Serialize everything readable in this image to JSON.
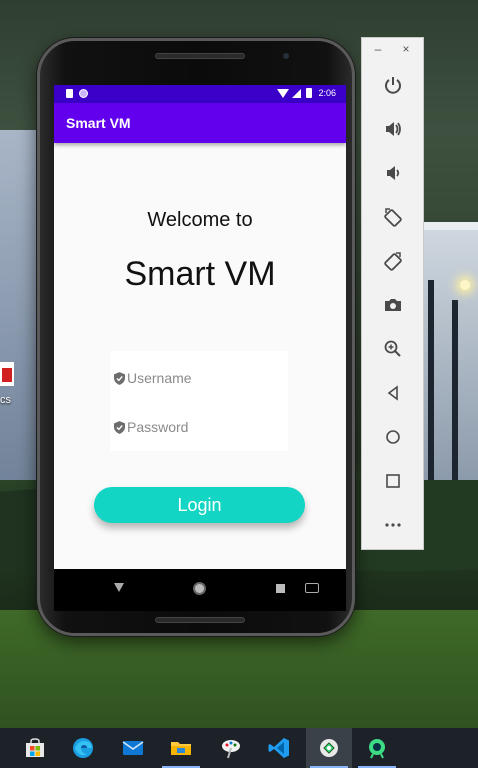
{
  "phone": {
    "status_bar": {
      "time": "2:06"
    },
    "app_bar": {
      "title": "Smart VM"
    },
    "welcome_text": "Welcome to",
    "app_name": "Smart VM",
    "form": {
      "username_placeholder": "Username",
      "password_placeholder": "Password"
    },
    "login_label": "Login"
  },
  "desktop": {
    "icon_label": "cs"
  },
  "emulator_toolbar": {
    "window_controls": {
      "minimize": "–",
      "close": "×"
    },
    "buttons": [
      "power-icon",
      "volume-up-icon",
      "volume-down-icon",
      "rotate-left-icon",
      "rotate-right-icon",
      "camera-icon",
      "zoom-icon",
      "back-icon",
      "home-icon",
      "overview-icon",
      "more-icon"
    ]
  },
  "taskbar": {
    "items": [
      "store-icon",
      "edge-icon",
      "mail-icon",
      "file-explorer-icon",
      "paint-icon",
      "vscode-icon",
      "android-studio-icon",
      "emulator-icon"
    ]
  },
  "colors": {
    "app_bar": "#6200ee",
    "status_bar": "#3a00c9",
    "login_button": "#12d5c4"
  }
}
